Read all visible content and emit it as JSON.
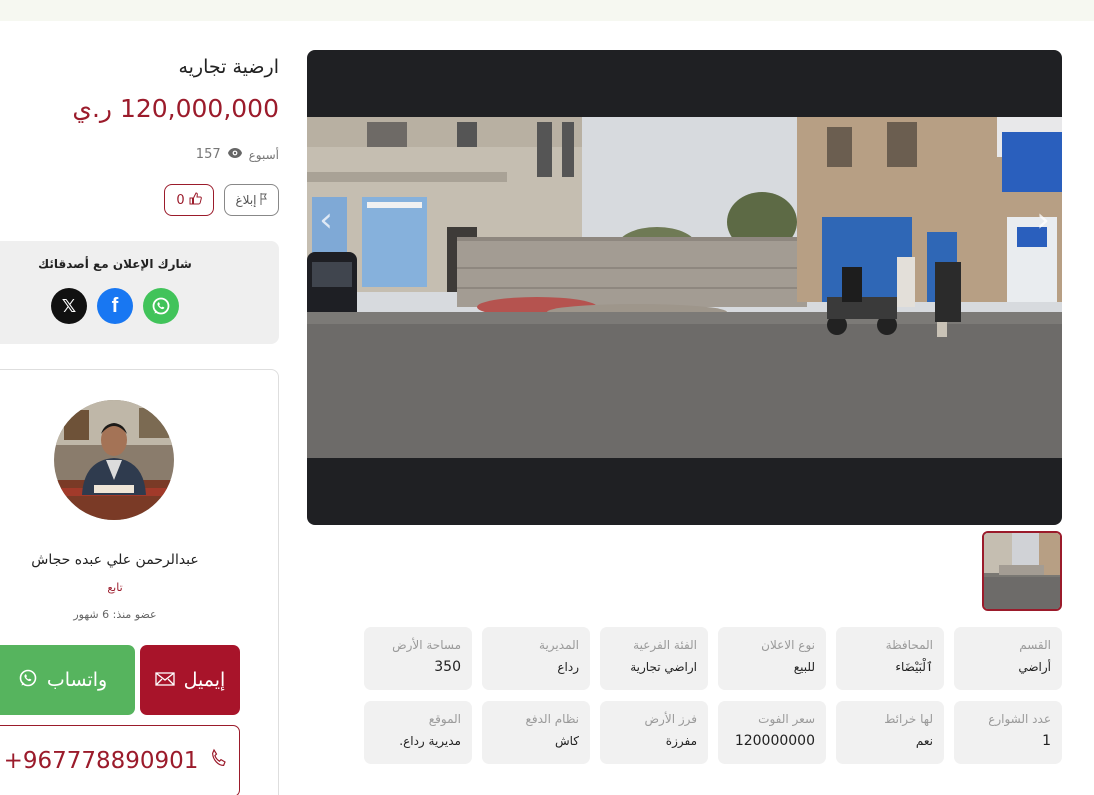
{
  "listing": {
    "title": "ارضية تجاريه",
    "price": "120,000,000 ر.ي",
    "posted": "أسبوع",
    "views": "157",
    "report_label": "إبلاغ",
    "likes": "0"
  },
  "share": {
    "title": "شارك الإعلان مع أصدقائك",
    "networks": [
      "x-icon",
      "facebook-icon",
      "whatsapp-icon"
    ]
  },
  "seller": {
    "name": "عبدالرحمن علي عبده حجاش",
    "role": "تابع",
    "member_since": "عضو منذ: 6 شهور"
  },
  "contact": {
    "email_label": "إيميل",
    "whatsapp_label": "واتساب",
    "phone": "+967778890901"
  },
  "details": {
    "row1": [
      {
        "label": "القسم",
        "value": "أراضي"
      },
      {
        "label": "المحافظة",
        "value": "ٱلْبَيْضَاء"
      },
      {
        "label": "نوع الاعلان",
        "value": "للبيع"
      },
      {
        "label": "الفئة الفرعية",
        "value": "اراضي تجارية"
      },
      {
        "label": "المديرية",
        "value": "رداع"
      },
      {
        "label": "مساحة الأرض",
        "value": "350"
      }
    ],
    "row2": [
      {
        "label": "عدد الشوارع",
        "value": "1"
      },
      {
        "label": "لها خرائط",
        "value": "نعم"
      },
      {
        "label": "سعر الفوت",
        "value": "120000000"
      },
      {
        "label": "فرز الأرض",
        "value": "مفرزة"
      },
      {
        "label": "نظام الدفع",
        "value": "كاش"
      },
      {
        "label": "الموقع",
        "value": "مديرية رداع."
      }
    ]
  },
  "colors": {
    "brand": "#9b1b2b",
    "email_button": "#a8142a",
    "whatsapp_button": "#56b45e",
    "facebook": "#1877f2",
    "whatsapp_share": "#41c35a"
  }
}
